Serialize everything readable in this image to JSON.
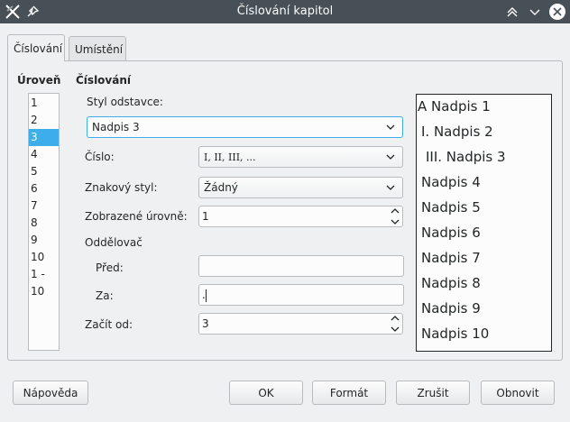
{
  "window": {
    "title": "Číslování kapitol"
  },
  "tabs": [
    {
      "label": "Číslování"
    },
    {
      "label": "Umístění"
    }
  ],
  "levels_panel": {
    "heading": "Úroveň",
    "items": [
      "1",
      "2",
      "3",
      "4",
      "5",
      "6",
      "7",
      "8",
      "9",
      "10",
      "1 - 10"
    ],
    "selected": "3"
  },
  "numbering": {
    "heading": "Číslování",
    "paragraph_style_label": "Styl odstavce:",
    "paragraph_style_value": "Nadpis 3",
    "number_label": "Číslo:",
    "number_value": "I, II, III, ...",
    "char_style_label": "Znakový styl:",
    "char_style_value": "Žádný",
    "shown_levels_label": "Zobrazené úrovně:",
    "shown_levels_value": "1",
    "separator_heading": "Oddělovač",
    "before_label": "Před:",
    "before_value": "",
    "after_label": "Za:",
    "after_value": ".",
    "start_at_label": "Začít od:",
    "start_at_value": "3"
  },
  "preview": {
    "lines": [
      "A Nadpis 1",
      "I. Nadpis 2",
      "III. Nadpis 3",
      "Nadpis 4",
      "Nadpis 5",
      "Nadpis 6",
      "Nadpis 7",
      "Nadpis 8",
      "Nadpis 9",
      "Nadpis 10"
    ]
  },
  "buttons": {
    "help": "Nápověda",
    "ok": "OK",
    "format": "Formát",
    "cancel": "Zrušit",
    "reset": "Obnovit"
  },
  "colors": {
    "titlebar": "#475057",
    "selection": "#3daee9"
  }
}
